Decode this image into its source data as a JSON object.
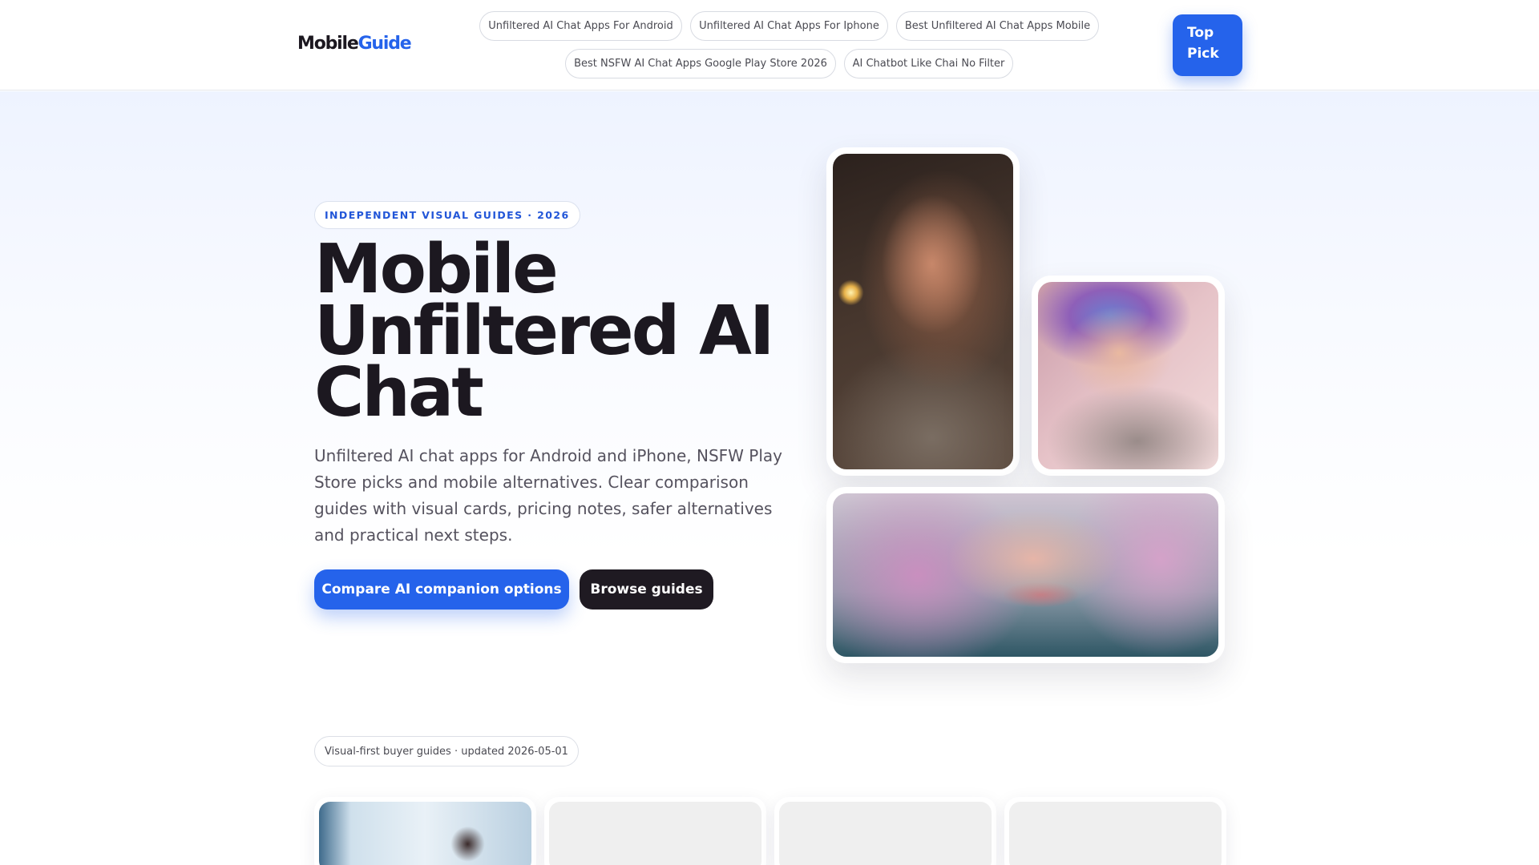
{
  "header": {
    "logo_part1": "Mobile",
    "logo_part2": "Guide",
    "nav_links": [
      "Unfiltered AI Chat Apps For Android",
      "Unfiltered AI Chat Apps For Iphone",
      "Best Unfiltered AI Chat Apps Mobile",
      "Best NSFW AI Chat Apps Google Play Store 2026",
      "AI Chatbot Like Chai No Filter"
    ],
    "top_pick_line1": "Top",
    "top_pick_line2": "Pick"
  },
  "hero": {
    "eyebrow": "INDEPENDENT VISUAL GUIDES · 2026",
    "title_line1": "Mobile",
    "title_line2": "Unfiltered AI",
    "title_line3": "Chat",
    "description": "Unfiltered AI chat apps for Android and iPhone, NSFW Play Store picks and mobile alternatives. Clear comparison guides with visual cards, pricing notes, safer alternatives and practical next steps.",
    "primary_cta": "Compare AI companion options",
    "secondary_cta": "Browse guides"
  },
  "guides": {
    "badge": "Visual-first buyer guides · updated 2026-05-01"
  },
  "colors": {
    "accent": "#2563eb",
    "dark": "#1f1a22",
    "text": "#1c1820"
  }
}
